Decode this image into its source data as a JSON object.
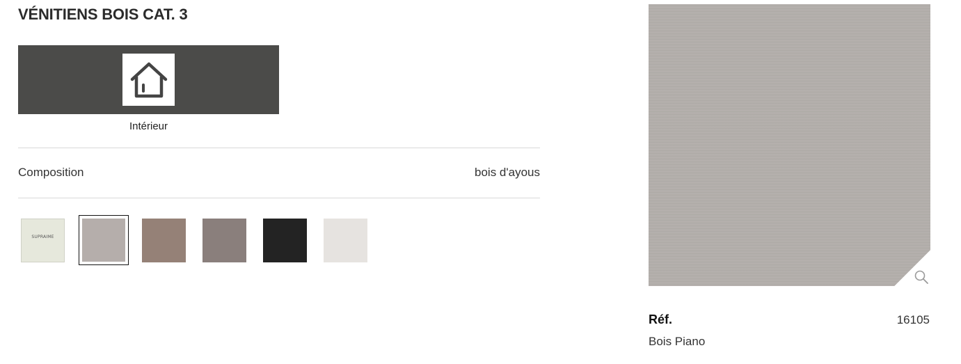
{
  "page": {
    "title": "VÉNITIENS BOIS CAT. 3"
  },
  "usage": {
    "icon": "house-icon",
    "label": "Intérieur"
  },
  "composition": {
    "label": "Composition",
    "value": "bois d'ayous"
  },
  "swatches": [
    {
      "color": "#e6e8dc",
      "text": "SUPRAIME",
      "selected": false
    },
    {
      "color": "#b5aeab",
      "text": "",
      "selected": true
    },
    {
      "color": "#958177",
      "text": "",
      "selected": false
    },
    {
      "color": "#8a7f7c",
      "text": "",
      "selected": false
    },
    {
      "color": "#232323",
      "text": "",
      "selected": false
    },
    {
      "color": "#e6e3e0",
      "text": "",
      "selected": false
    }
  ],
  "preview": {
    "color": "#b3aeab",
    "zoom_icon": "magnifier-icon"
  },
  "product": {
    "ref_label": "Réf.",
    "ref_value": "16105",
    "name": "Bois Piano"
  }
}
